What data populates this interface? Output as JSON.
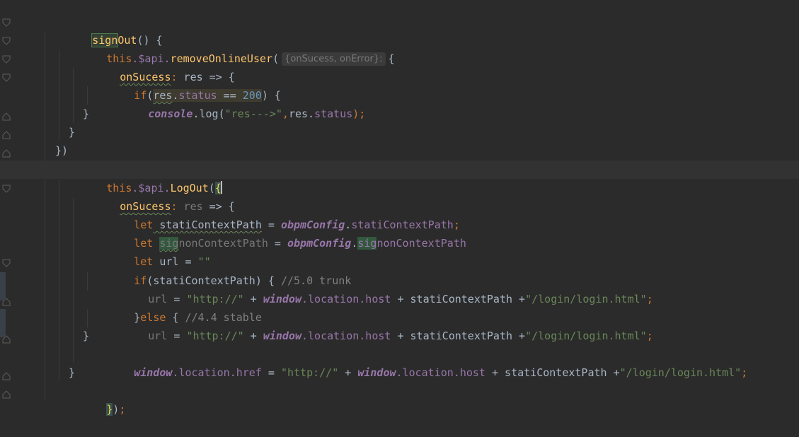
{
  "editor": {
    "language": "javascript",
    "hint_param_names": "{onSucess, onError}:",
    "lines": [
      {
        "t1": "sign",
        "t1b": "Out",
        "t2": "() {"
      },
      {
        "this": "this",
        "dollar": ".$api.",
        "method": "removeOnlineUser",
        "paren": "(",
        "brace": "{"
      },
      {
        "name": "onSucess",
        "colon": ":",
        "rest": " res => {"
      },
      {
        "if": "if",
        "open": "(",
        "res": "res",
        "dot": ".",
        "status": "status",
        "op": " == ",
        "num": "200",
        "close": ")",
        "tail": " {"
      },
      {
        "console": "console",
        "dot": ".",
        "log": "log",
        "open": "(",
        "str": "\"res--->\"",
        "comma": ",",
        "res": "res",
        "dot2": ".",
        "status": "status",
        "close": ");"
      },
      {
        "text": "}"
      },
      {
        "text": "}"
      },
      {
        "text": "})"
      },
      {
        "this": "this",
        "dollar": ".$api.",
        "method": "LogOut",
        "paren": "(",
        "brace": "{"
      },
      {
        "name": "onSucess",
        "colon": ":",
        "res": " res",
        "rest": " => {"
      },
      {
        "let": "let",
        "var": " statiContextPath",
        "eq": " = ",
        "glob": "obpmConfig",
        "dot": ".",
        "prop": "statiContextPath",
        "semi": ";"
      },
      {
        "let": "let",
        "sp": " ",
        "var_a": "sig",
        "var_b": "nonContextPath",
        "eq": " = ",
        "glob": "obpmConfig",
        "dot": ".",
        "prop_a": "sig",
        "prop_b": "nonContextPath"
      },
      {
        "let": "let",
        "rest": " url = ",
        "str": "\"\""
      },
      {
        "if": "if",
        "cond": "(statiContextPath) { ",
        "cmt": "//5.0 trunk"
      },
      {
        "url": "url",
        "eq": " = ",
        "str1": "\"http://\"",
        "plus": " + ",
        "glob": "window",
        "loc": ".location.host",
        "plus2": " + statiContextPath +",
        "str2": "\"/login/login.html\"",
        "semi": ";"
      },
      {
        "close": "}",
        "else": "else",
        "rest": " { ",
        "cmt": "//4.4 stable"
      },
      {
        "url": "url",
        "eq": " = ",
        "str1": "\"http://\"",
        "plus": " + ",
        "glob": "window",
        "loc": ".location.host",
        "plus2": " + statiContextPath +",
        "str2": "\"/login/login.html\"",
        "semi": ";"
      },
      {
        "text": "}"
      },
      {
        "glob": "window",
        "loc": ".location.href",
        "eq": " = ",
        "str1": "\"http://\"",
        "plus": " + ",
        "glob2": "window",
        "loc2": ".location.host",
        "plus2": " + statiContextPath +",
        "str2": "\"/login/login.html\"",
        "semi": ";"
      },
      {
        "text": "}"
      },
      {
        "brace": "}",
        "rest": ")",
        "semi": ";"
      }
    ]
  }
}
